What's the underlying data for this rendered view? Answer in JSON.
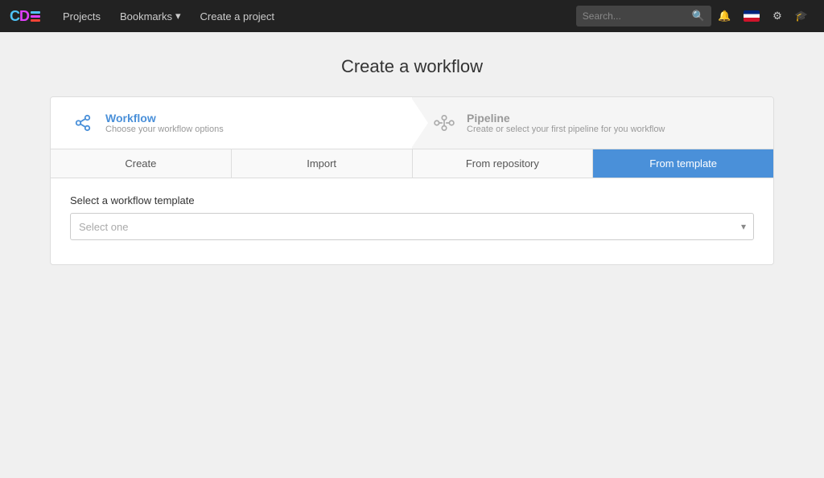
{
  "nav": {
    "logo": {
      "c": "C",
      "d": "D",
      "e": "E"
    },
    "links": [
      {
        "label": "Projects",
        "id": "projects"
      },
      {
        "label": "Bookmarks",
        "id": "bookmarks",
        "dropdown": true
      },
      {
        "label": "Create a project",
        "id": "create-project"
      }
    ],
    "search_placeholder": "Search...",
    "icons": [
      "bell",
      "flag",
      "settings",
      "cap"
    ]
  },
  "page": {
    "title": "Create a workflow"
  },
  "wizard": {
    "steps": [
      {
        "id": "workflow",
        "name": "Workflow",
        "desc": "Choose your workflow options",
        "active": true,
        "icon": "share"
      },
      {
        "id": "pipeline",
        "name": "Pipeline",
        "desc": "Create or select your first pipeline for you workflow",
        "active": false,
        "icon": "pipeline"
      }
    ],
    "tabs": [
      {
        "label": "Create",
        "id": "create",
        "active": false
      },
      {
        "label": "Import",
        "id": "import",
        "active": false
      },
      {
        "label": "From repository",
        "id": "from-repository",
        "active": false
      },
      {
        "label": "From template",
        "id": "from-template",
        "active": true
      }
    ],
    "form": {
      "label": "Select a workflow template",
      "select_placeholder": "Select one"
    }
  }
}
